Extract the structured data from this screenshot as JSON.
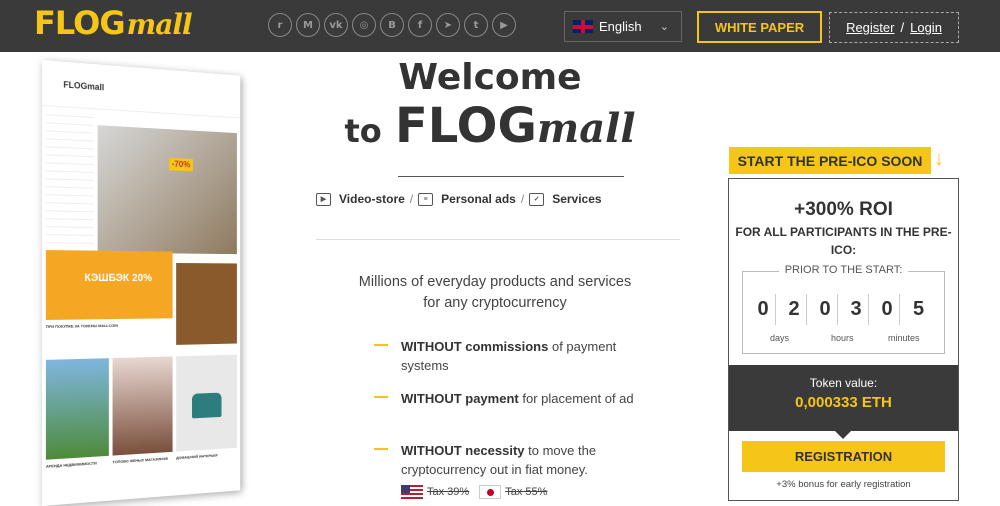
{
  "header": {
    "logo_main": "FLOG",
    "logo_script": "mall",
    "socials": [
      {
        "icon": "reddit-icon",
        "glyph": "r"
      },
      {
        "icon": "medium-icon",
        "glyph": "M"
      },
      {
        "icon": "vk-icon",
        "glyph": "vk"
      },
      {
        "icon": "instagram-icon",
        "glyph": "◎"
      },
      {
        "icon": "bitcoin-icon",
        "glyph": "B"
      },
      {
        "icon": "facebook-icon",
        "glyph": "f"
      },
      {
        "icon": "telegram-icon",
        "glyph": "➤"
      },
      {
        "icon": "twitter-icon",
        "glyph": "t"
      },
      {
        "icon": "youtube-icon",
        "glyph": "▶"
      }
    ],
    "language": "English",
    "white_paper": "WHITE PAPER",
    "register": "Register",
    "auth_sep": "/",
    "login": "Login"
  },
  "mockup": {
    "logo": "FLOGmall",
    "banner_text": "-70%",
    "cashback": "КЭШБЭК 20%",
    "cashback_caption": "ПРИ ПОКУПКЕ ЗА ТОКЕНЫ MALLCOIN",
    "captions": [
      "АРЕНДА НЕДВИЖИМОСТИ",
      "ТОПОВО ЖЕНЫХ МАГАЗИНОВ",
      "ДОМАШНИЙ ИНТЕРЬЕР"
    ]
  },
  "hero": {
    "welcome": "Welcome",
    "to": "to",
    "brand_main": "FLOG",
    "brand_script": "mall",
    "features": [
      {
        "icon": "video-icon",
        "label": "Video-store"
      },
      {
        "icon": "document-icon",
        "label": "Personal ads"
      },
      {
        "icon": "services-icon",
        "label": "Services"
      }
    ],
    "tagline_1": "Millions of everyday products and services",
    "tagline_2": "for any cryptocurrency",
    "benefits": [
      {
        "bold": "WITHOUT commissions",
        "rest": " of payment systems"
      },
      {
        "bold": "WITHOUT payment",
        "rest": " for placement of ad"
      },
      {
        "bold": "WITHOUT necessity",
        "rest": " to move the cryptocurrency out in fiat money."
      }
    ],
    "taxes": [
      {
        "flag": "us-flag-icon",
        "label": "Tax 39%"
      },
      {
        "flag": "japan-flag-icon",
        "label": "Tax 55%"
      }
    ]
  },
  "preico": {
    "banner": "START THE PRE-ICO SOON",
    "roi": "+300% ROI",
    "roi_sub": "FOR ALL PARTICIPANTS IN THE PRE-ICO:",
    "prior": "PRIOR TO THE START:",
    "digits": [
      "0",
      "2",
      "0",
      "3",
      "0",
      "5"
    ],
    "units": [
      "days",
      "hours",
      "minutes"
    ],
    "token_label": "Token value:",
    "token_value": "0,000333 ETH",
    "registration": "REGISTRATION",
    "bonus": "+3% bonus for early registration"
  }
}
